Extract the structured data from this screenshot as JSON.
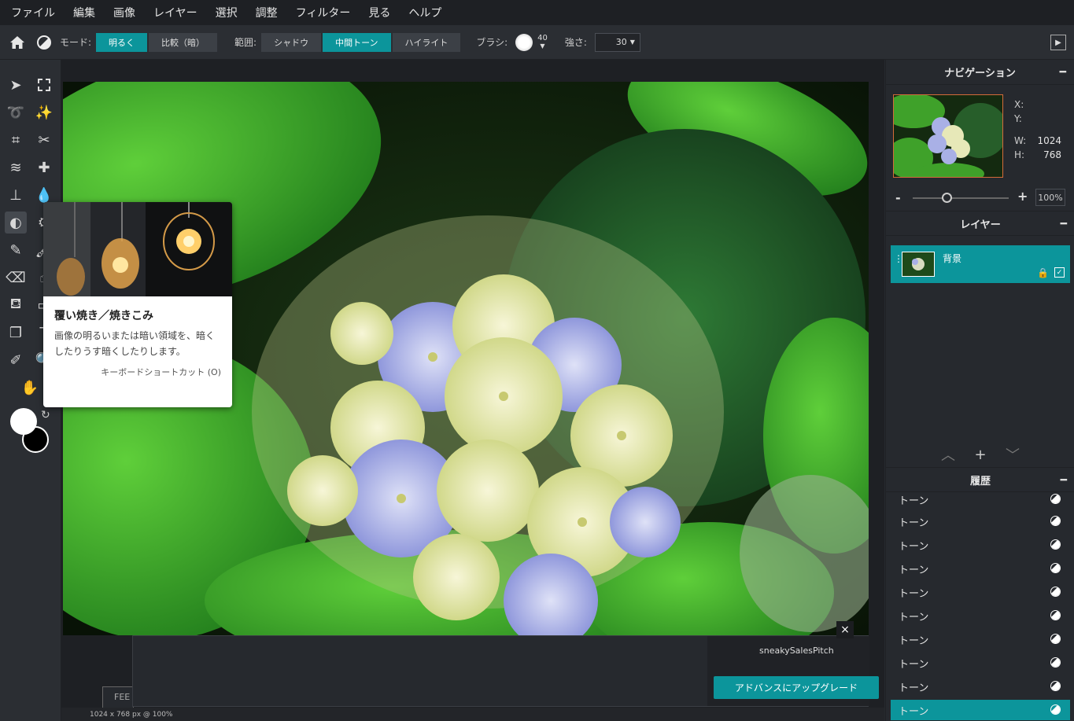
{
  "menu": [
    "ファイル",
    "編集",
    "画像",
    "レイヤー",
    "選択",
    "調整",
    "フィルター",
    "見る",
    "ヘルプ"
  ],
  "options": {
    "mode_label": "モード:",
    "mode_buttons": [
      {
        "label": "明るく",
        "active": true
      },
      {
        "label": "比較（暗）",
        "active": false
      }
    ],
    "range_label": "範囲:",
    "range_buttons": [
      {
        "label": "シャドウ",
        "active": false
      },
      {
        "label": "中間トーン",
        "active": true
      },
      {
        "label": "ハイライト",
        "active": false
      }
    ],
    "brush_label": "ブラシ:",
    "brush_size": "40",
    "strength_label": "強さ:",
    "strength_value": "30"
  },
  "tooltip": {
    "title": "覆い焼き／焼きこみ",
    "description": "画像の明るいまたは暗い領域を、暗くしたりうす暗くしたりします。",
    "shortcut": "キーボードショートカット (O)"
  },
  "navigation": {
    "title": "ナビゲーション",
    "x_label": "X:",
    "y_label": "Y:",
    "w_label": "W:",
    "w_value": "1024",
    "h_label": "H:",
    "h_value": "768",
    "zoom_minus": "-",
    "zoom_plus": "+",
    "zoom_value": "100%",
    "zoom_level": 0.35
  },
  "layers": {
    "title": "レイヤー",
    "items": [
      {
        "name": "背景"
      }
    ]
  },
  "history": {
    "title": "履歴",
    "items": [
      "トーン",
      "トーン",
      "トーン",
      "トーン",
      "トーン",
      "トーン",
      "トーン",
      "トーン",
      "トーン",
      "トーン"
    ]
  },
  "ad": {
    "pitch": "sneakySalesPitch",
    "upgrade_label": "アドバンスにアップグレード",
    "close": "×",
    "feedback_label": "FEE"
  },
  "status": {
    "info": "1024 x 768 px @ 100%"
  },
  "colors": {
    "accent": "#0c959b",
    "foreground": "#ffffff",
    "background": "#000000"
  }
}
